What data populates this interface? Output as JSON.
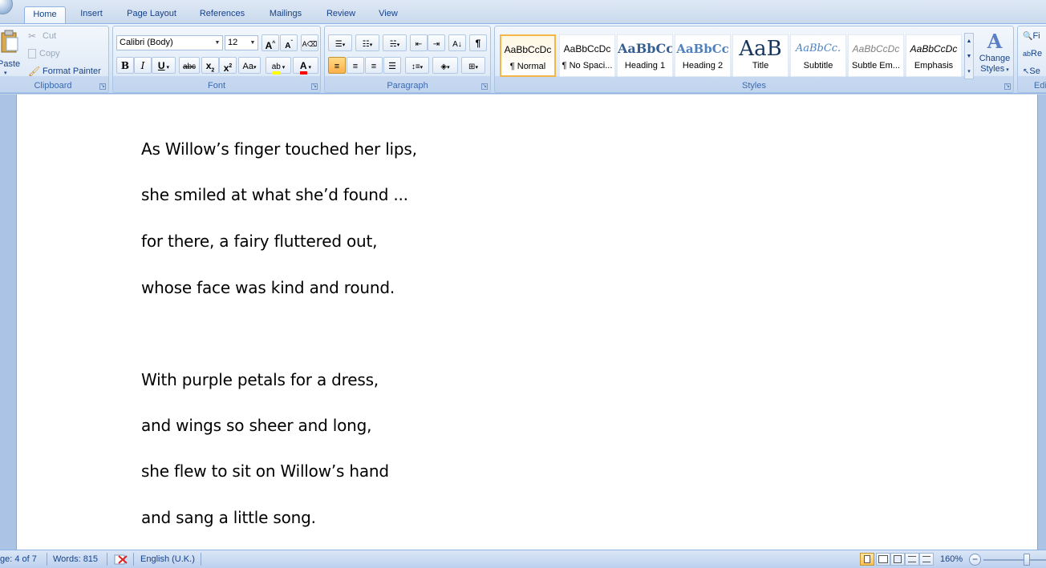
{
  "tabs": [
    "Home",
    "Insert",
    "Page Layout",
    "References",
    "Mailings",
    "Review",
    "View"
  ],
  "clipboard": {
    "paste_label": "Paste",
    "cut_label": "Cut",
    "copy_label": "Copy",
    "format_painter_label": "Format Painter",
    "group_label": "Clipboard"
  },
  "font": {
    "font_name": "Calibri (Body)",
    "font_size": "12",
    "group_label": "Font"
  },
  "paragraph": {
    "group_label": "Paragraph"
  },
  "styles": {
    "group_label": "Styles",
    "items": [
      {
        "sample": "AaBbCcDc",
        "name": "¶ Normal"
      },
      {
        "sample": "AaBbCcDc",
        "name": "¶ No Spaci..."
      },
      {
        "sample": "AaBbCc",
        "name": "Heading 1"
      },
      {
        "sample": "AaBbCc",
        "name": "Heading 2"
      },
      {
        "sample": "AaB",
        "name": "Title"
      },
      {
        "sample": "AaBbCc.",
        "name": "Subtitle"
      },
      {
        "sample": "AaBbCcDc",
        "name": "Subtle Em..."
      },
      {
        "sample": "AaBbCcDc",
        "name": "Emphasis"
      }
    ],
    "change_styles_label_1": "Change",
    "change_styles_label_2": "Styles"
  },
  "editing": {
    "find_label": "Fi",
    "replace_label": "Re",
    "select_label": "Se",
    "group_label": "Edi"
  },
  "document": {
    "lines": [
      "As Willow’s finger touched her lips,",
      "she smiled at what she’d found ...",
      "for there, a fairy fluttered out,",
      "whose face was kind and round.",
      "With purple petals for a  dress,",
      "and wings so sheer and long,",
      "she flew to sit on Willow’s hand",
      "and sang a little song."
    ]
  },
  "status": {
    "page": "ge: 4 of 7",
    "words": "Words: 815",
    "language": "English (U.K.)",
    "zoom": "160%"
  }
}
